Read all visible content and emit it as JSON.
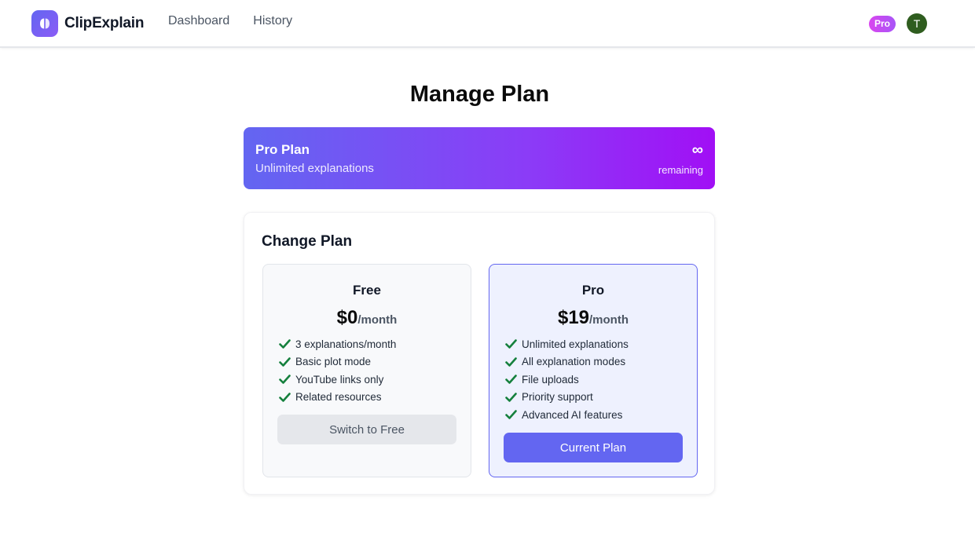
{
  "header": {
    "brand": "ClipExplain",
    "nav": [
      {
        "label": "Dashboard"
      },
      {
        "label": "History"
      }
    ],
    "badge": "Pro",
    "avatar_initial": "T"
  },
  "page_title": "Manage Plan",
  "current_plan": {
    "title": "Pro Plan",
    "subtitle": "Unlimited explanations",
    "remaining_value": "∞",
    "remaining_label": "remaining"
  },
  "change_plan": {
    "title": "Change Plan",
    "plans": [
      {
        "name": "Free",
        "price": "$0",
        "period": "/month",
        "features": [
          "3 explanations/month",
          "Basic plot mode",
          "YouTube links only",
          "Related resources"
        ],
        "button": "Switch to Free"
      },
      {
        "name": "Pro",
        "price": "$19",
        "period": "/month",
        "features": [
          "Unlimited explanations",
          "All explanation modes",
          "File uploads",
          "Priority support",
          "Advanced AI features"
        ],
        "button": "Current Plan"
      }
    ]
  },
  "colors": {
    "accent": "#6366f1",
    "banner_end": "#a10ff5",
    "check": "#15803d",
    "avatar": "#2f5d1f"
  },
  "icons": {
    "logo": "brain-logo-icon",
    "feature": "checkmark-icon"
  }
}
